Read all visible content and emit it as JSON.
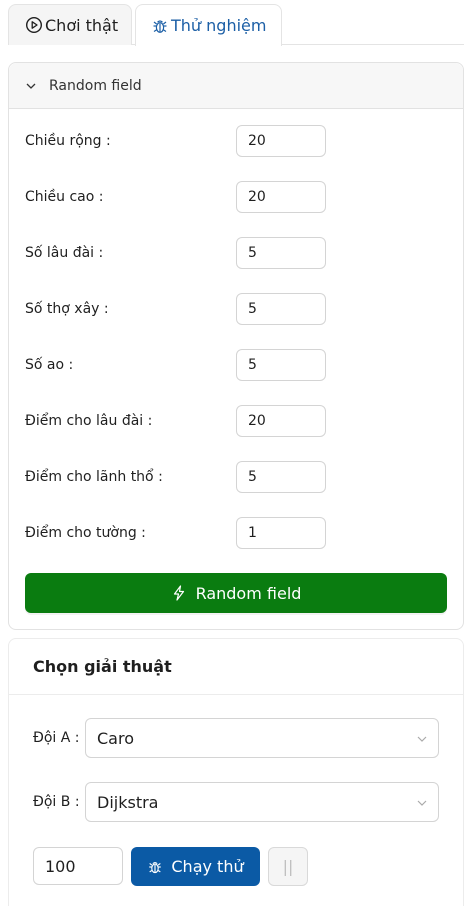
{
  "tabs": [
    {
      "label": "Chơi thật",
      "icon": "play-circle-icon",
      "active": false
    },
    {
      "label": "Thử nghiệm",
      "icon": "bug-icon",
      "active": true
    }
  ],
  "random_panel": {
    "header": "Random field",
    "fields": [
      {
        "label": "Chiều rộng",
        "value": "20"
      },
      {
        "label": "Chiều cao",
        "value": "20"
      },
      {
        "label": "Số lâu đài",
        "value": "5"
      },
      {
        "label": "Số thợ xây",
        "value": "5"
      },
      {
        "label": "Số ao",
        "value": "5"
      },
      {
        "label": "Điểm cho lâu đài",
        "value": "20"
      },
      {
        "label": "Điểm cho lãnh thổ",
        "value": "5"
      },
      {
        "label": "Điểm cho tường",
        "value": "1"
      }
    ],
    "colon": ":",
    "button_label": "Random field",
    "button_color": "#0a7c10"
  },
  "algorithm_panel": {
    "title": "Chọn giải thuật",
    "team_a": {
      "label": "Đội A",
      "value": "Caro"
    },
    "team_b": {
      "label": "Đội B",
      "value": "Dijkstra"
    },
    "colon": ":",
    "steps": "100",
    "run_label": "Chạy thử",
    "pause_label": "||",
    "run_color": "#0b5aa5"
  }
}
